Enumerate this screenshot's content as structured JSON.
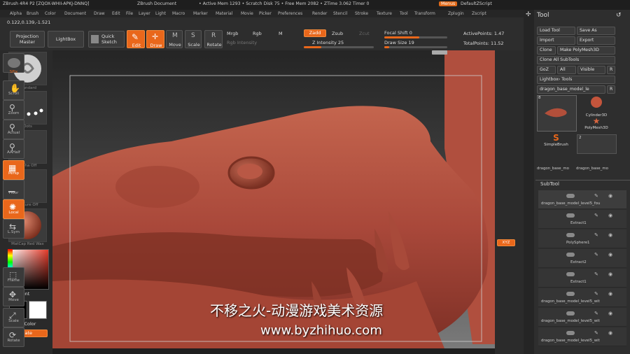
{
  "menubar": {
    "title": "ZBrush 4R4 P2 [ZQOX-WHII-APKJ-DNNQ]",
    "doc": "ZBrush Document",
    "stats": "• Active Mem 1293 • Scratch Disk 75 • Free Mem 2082 • ZTime 3.062 Timer 0",
    "menus_label": "Menus",
    "script": "DefaultZScript",
    "items": [
      "Alpha",
      "Brush",
      "Color",
      "Document",
      "Draw",
      "Edit",
      "File",
      "Layer",
      "Light",
      "Macro",
      "Marker",
      "Material",
      "Movie",
      "Picker",
      "Preferences",
      "Render",
      "Stencil",
      "Stroke",
      "Texture",
      "Tool",
      "Transform",
      "Zplugin",
      "Zscript"
    ]
  },
  "coords": "0.122,0.139,-1.521",
  "toolbar": {
    "projection_master": "Projection Master",
    "lightbox": "LightBox",
    "quick_sketch": "Quick Sketch",
    "edit": "Edit",
    "draw": "Draw",
    "move": "Move",
    "scale": "Scale",
    "rotate": "Rotate",
    "mrgb": "Mrgb",
    "rgb": "Rgb",
    "m": "M",
    "rgb_intensity": "Rgb Intensity",
    "zadd": "Zadd",
    "zsub": "Zsub",
    "zcut": "Zcut",
    "z_intensity": "Z Intensity 25",
    "focal_shift": "Focal Shift 0",
    "draw_size": "Draw Size 19",
    "active_points": "ActivePoints: 1.47",
    "total_points": "TotalPoints: 11.52"
  },
  "left": {
    "standard": "Standard",
    "dots": "Dots",
    "alpha_off": "Alpha Off",
    "texture_off": "Texture Off",
    "matcap": "MatCap Red Wax",
    "gradient": "Gradient",
    "switchcolor": "SwitchColor",
    "alternate": "Alternate"
  },
  "shelf": [
    "BPR",
    "SPix",
    "Scroll",
    "Zoom",
    "Actual",
    "AAHalf",
    "Persp",
    "Floor",
    "Local",
    "L.Sym",
    "XYZ",
    "Frame",
    "Move",
    "Scale",
    "Rotate"
  ],
  "toolpanel": {
    "title": "Tool",
    "load_tool": "Load Tool",
    "save_as": "Save As",
    "import": "Import",
    "export": "Export",
    "clone": "Clone",
    "make_polymesh": "Make PolyMesh3D",
    "clone_all": "Clone All SubTools",
    "goz": "GoZ",
    "all": "All",
    "visible": "Visible",
    "r": "R",
    "lightbox_tools": "Lightbox› Tools",
    "current_tool": "dragon_base_model_le",
    "tools": [
      "Cylinder3D",
      "PolyMesh3D",
      "SimpleBrush"
    ],
    "tool_counts": [
      "8",
      "2"
    ],
    "tool_names": [
      "dragon_base_mo",
      "dragon_base_mo"
    ],
    "subtool_title": "SubTool",
    "subtools": [
      "dragon_base_model_level5_fou",
      "Extract1",
      "PolySphere1",
      "Extract2",
      "Extract1",
      "dragon_base_model_level5_wit",
      "dragon_base_model_level5_wit",
      "dragon_base_model_level5_wit"
    ]
  },
  "watermark": {
    "line1": "不移之火-动漫游戏美术资源",
    "line2": "www.byzhihuo.com"
  },
  "colors": {
    "accent": "#e9671b",
    "clay": "#b5533f"
  }
}
